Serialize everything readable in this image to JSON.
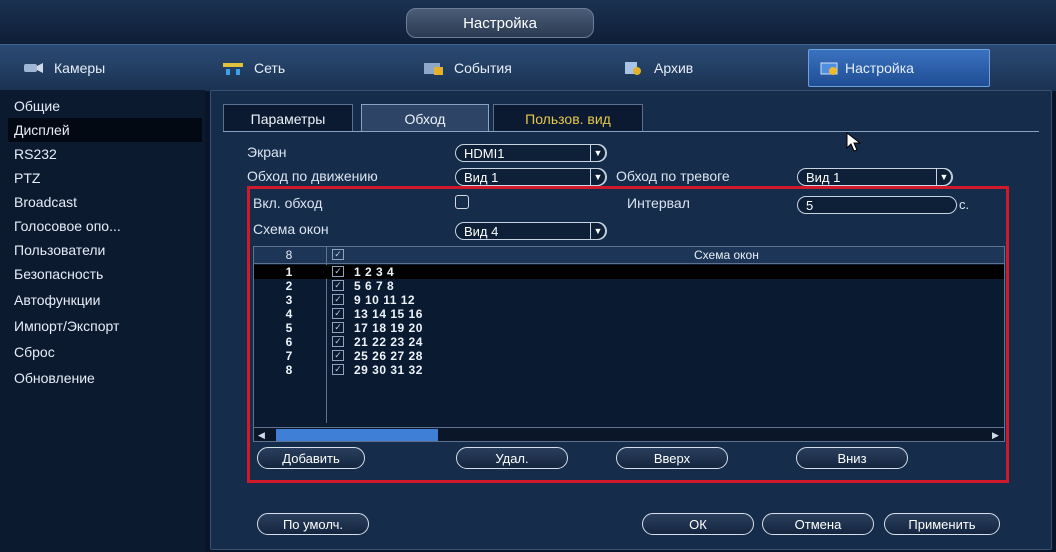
{
  "window": {
    "title": "Настройка"
  },
  "menu": [
    {
      "label": "Камеры",
      "icon": "cameras-icon"
    },
    {
      "label": "Сеть",
      "icon": "network-icon"
    },
    {
      "label": "События",
      "icon": "events-icon"
    },
    {
      "label": "Архив",
      "icon": "archive-icon"
    },
    {
      "label": "Настройка",
      "icon": "settings-icon",
      "active": true
    }
  ],
  "sidebar": [
    {
      "label": "Общие"
    },
    {
      "label": "Дисплей",
      "active": true
    },
    {
      "label": "RS232"
    },
    {
      "label": "PTZ"
    },
    {
      "label": "Broadcast"
    },
    {
      "label": "Голосовое опо..."
    },
    {
      "label": "Пользователи"
    },
    {
      "label": "Безопасность"
    },
    {
      "label": "Автофункции"
    },
    {
      "label": "Импорт/Экспорт"
    },
    {
      "label": "Сброс"
    },
    {
      "label": "Обновление"
    }
  ],
  "tabs": [
    {
      "label": "Параметры"
    },
    {
      "label": "Обход",
      "active": true
    },
    {
      "label": "Пользов. вид",
      "highlight": true
    }
  ],
  "form": {
    "screen_label": "Экран",
    "screen_value": "HDMI1",
    "motion_tour_label": "Обход по движению",
    "motion_tour_value": "Вид 1",
    "alarm_tour_label": "Обход по тревоге",
    "alarm_tour_value": "Вид 1",
    "enable_tour_label": "Вкл. обход",
    "interval_label": "Интервал",
    "interval_value": "5",
    "interval_unit": "с.",
    "layout_label": "Схема окон",
    "layout_value": "Вид 4"
  },
  "table": {
    "header_num": "8",
    "header_windows": "Схема окон",
    "rows": [
      {
        "num": "1",
        "windows": "1 2 3 4"
      },
      {
        "num": "2",
        "windows": "5 6 7 8"
      },
      {
        "num": "3",
        "windows": "9 10 11 12"
      },
      {
        "num": "4",
        "windows": "13 14 15 16"
      },
      {
        "num": "5",
        "windows": "17 18 19 20"
      },
      {
        "num": "6",
        "windows": "21 22 23 24"
      },
      {
        "num": "7",
        "windows": "25 26 27 28"
      },
      {
        "num": "8",
        "windows": "29 30 31 32"
      }
    ]
  },
  "table_buttons": {
    "add": "Добавить",
    "delete": "Удал.",
    "up": "Вверх",
    "down": "Вниз"
  },
  "footer_buttons": {
    "default": "По умолч.",
    "ok": "ОК",
    "cancel": "Отмена",
    "apply": "Применить"
  }
}
